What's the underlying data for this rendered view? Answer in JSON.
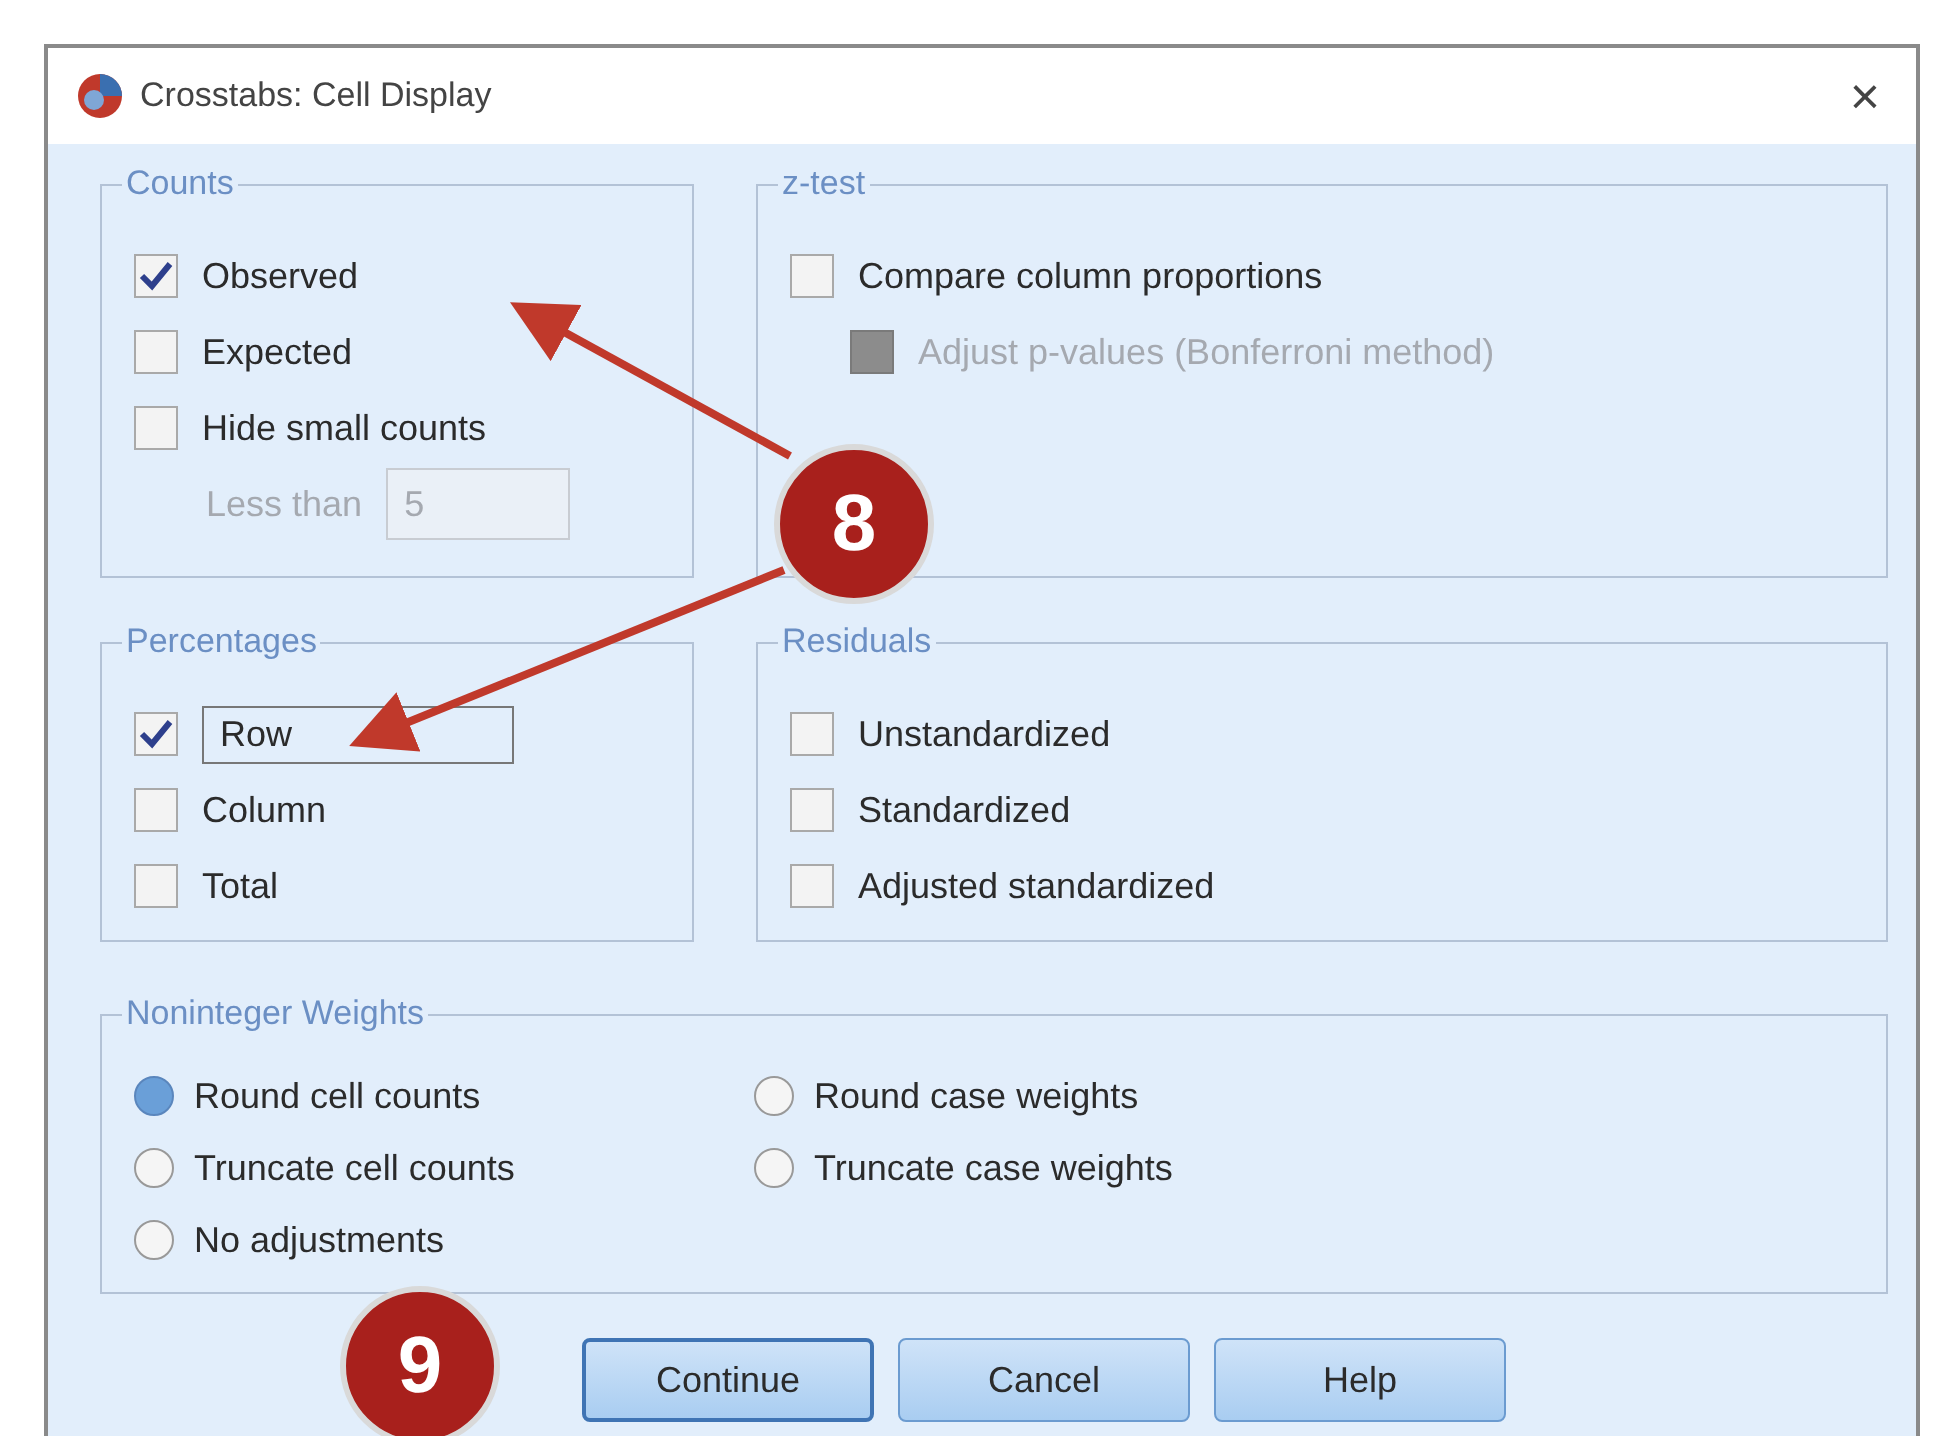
{
  "window": {
    "title": "Crosstabs: Cell Display",
    "close": "×"
  },
  "counts": {
    "title": "Counts",
    "items": [
      {
        "label": "Observed",
        "checked": true,
        "disabled": false
      },
      {
        "label": "Expected",
        "checked": false,
        "disabled": false
      },
      {
        "label": "Hide small counts",
        "checked": false,
        "disabled": false
      }
    ],
    "less_than": {
      "label": "Less than",
      "value": "5",
      "disabled": true
    }
  },
  "z_test": {
    "title": "z-test",
    "items": [
      {
        "label": "Compare column proportions",
        "checked": false,
        "disabled": false,
        "kind": "main"
      },
      {
        "label": "Adjust p-values (Bonferroni method)",
        "checked": false,
        "disabled": true,
        "kind": "sub"
      }
    ]
  },
  "percentages": {
    "title": "Percentages",
    "items": [
      {
        "label": "Row",
        "checked": true,
        "disabled": false,
        "focused": true
      },
      {
        "label": "Column",
        "checked": false,
        "disabled": false,
        "focused": false
      },
      {
        "label": "Total",
        "checked": false,
        "disabled": false,
        "focused": false
      }
    ]
  },
  "residuals": {
    "title": "Residuals",
    "items": [
      {
        "label": "Unstandardized",
        "checked": false,
        "disabled": false
      },
      {
        "label": "Standardized",
        "checked": false,
        "disabled": false
      },
      {
        "label": "Adjusted standardized",
        "checked": false,
        "disabled": false
      }
    ]
  },
  "noninteger_weights": {
    "title": "Noninteger Weights",
    "options": [
      {
        "label": "Round cell counts",
        "selected": true
      },
      {
        "label": "Round case weights",
        "selected": false
      },
      {
        "label": "Truncate cell counts",
        "selected": false
      },
      {
        "label": "Truncate case weights",
        "selected": false
      },
      {
        "label": "No adjustments",
        "selected": false
      }
    ]
  },
  "buttons": [
    {
      "label": "Continue",
      "default": true
    },
    {
      "label": "Cancel",
      "default": false
    },
    {
      "label": "Help",
      "default": false
    }
  ],
  "callouts": [
    {
      "number": "8"
    },
    {
      "number": "9"
    }
  ]
}
